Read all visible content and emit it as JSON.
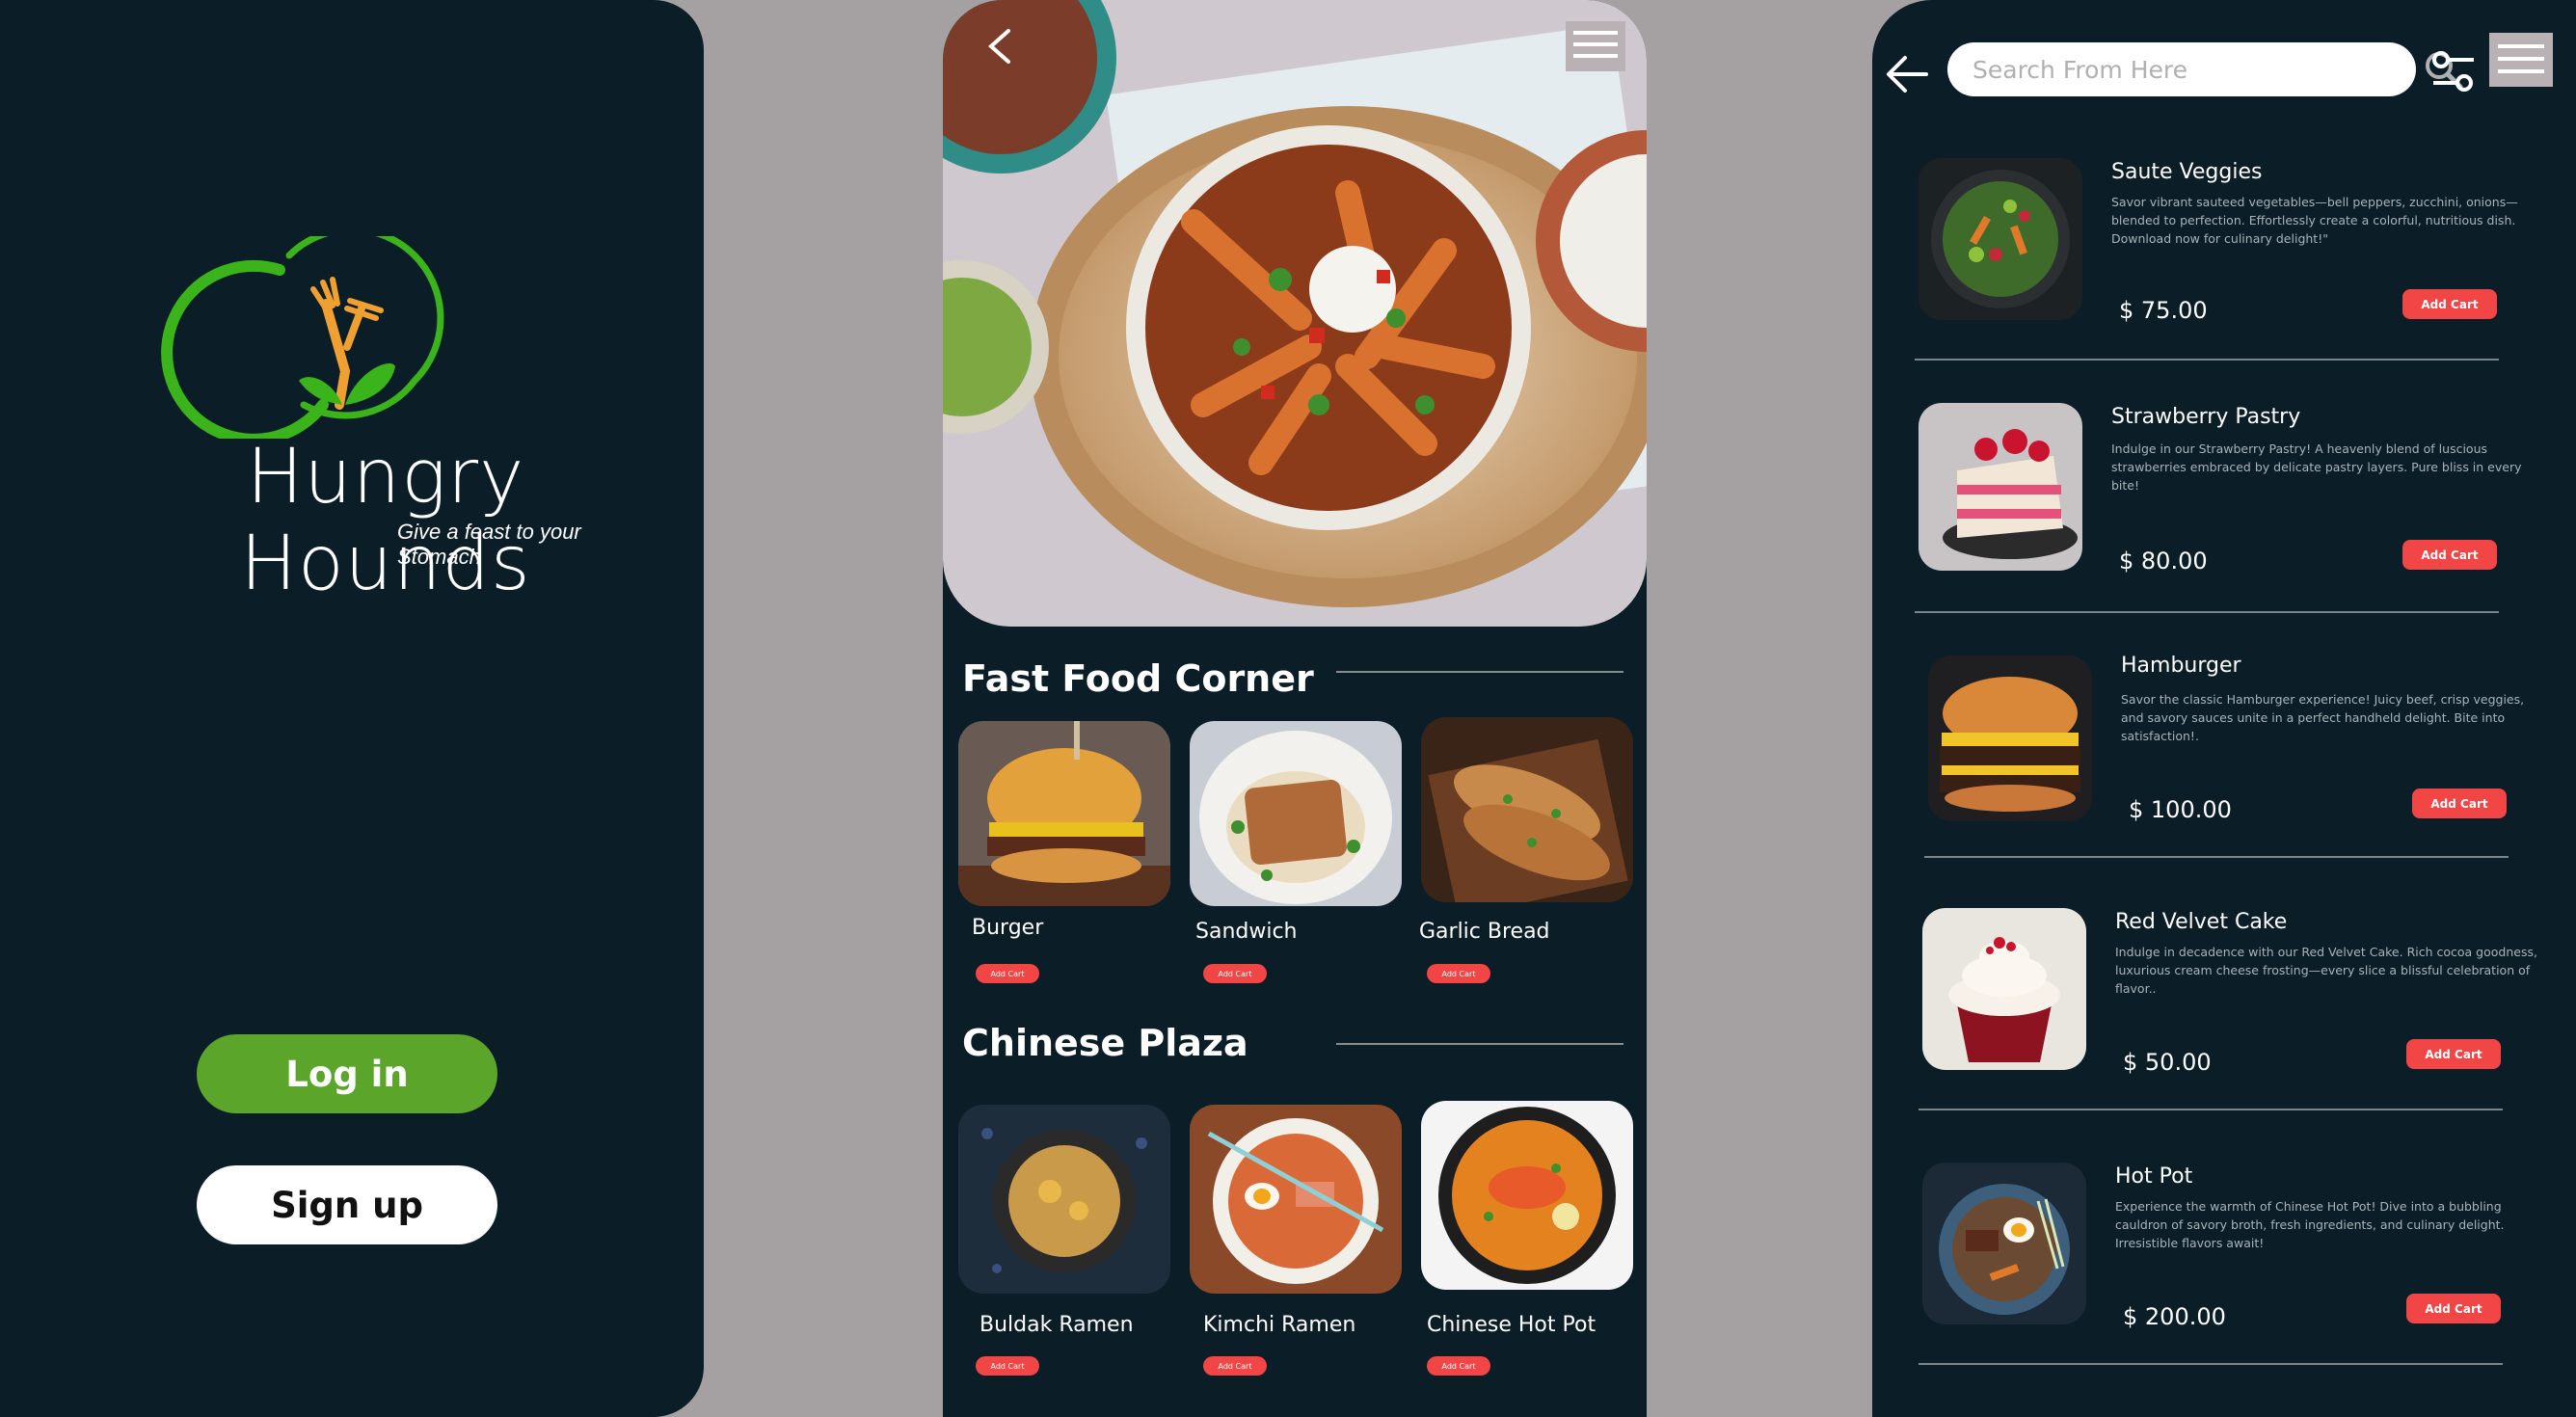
{
  "welcome": {
    "brand": "Hungry Hounds",
    "tagline": "Give a feast to your Stomach",
    "login_label": "Log in",
    "signup_label": "Sign up"
  },
  "home": {
    "sections": [
      {
        "title": "Fast Food Corner",
        "items": [
          {
            "name": "Burger",
            "button": "Add Cart"
          },
          {
            "name": "Sandwich",
            "button": "Add Cart"
          },
          {
            "name": "Garlic Bread",
            "button": "Add Cart"
          }
        ]
      },
      {
        "title": "Chinese Plaza",
        "items": [
          {
            "name": "Buldak Ramen",
            "button": "Add Cart"
          },
          {
            "name": "Kimchi Ramen",
            "button": "Add Cart"
          },
          {
            "name": "Chinese Hot Pot",
            "button": "Add Cart"
          }
        ]
      }
    ]
  },
  "listing": {
    "search_placeholder": "Search From Here",
    "items": [
      {
        "name": "Saute Veggies",
        "description": "Savor vibrant sauteed vegetables—bell peppers, zucchini, onions—blended to perfection. Effortlessly create a colorful, nutritious dish. Download now for culinary delight!\"",
        "price": "$ 75.00",
        "button": "Add Cart"
      },
      {
        "name": "Strawberry Pastry",
        "description": "Indulge in our Strawberry Pastry! A heavenly blend of luscious strawberries embraced by delicate pastry layers. Pure bliss in every bite!",
        "price": "$ 80.00",
        "button": "Add Cart"
      },
      {
        "name": "Hamburger",
        "description": "Savor the classic Hamburger experience! Juicy beef, crisp veggies, and savory sauces unite in a perfect handheld delight. Bite into satisfaction!.",
        "price": "$ 100.00",
        "button": "Add Cart"
      },
      {
        "name": "Red Velvet Cake",
        "description": "Indulge in decadence with our Red Velvet Cake. Rich cocoa goodness, luxurious cream cheese frosting—every slice a blissful celebration of flavor..",
        "price": "$ 50.00",
        "button": "Add Cart"
      },
      {
        "name": "Hot Pot",
        "description": "Experience the warmth of Chinese Hot Pot! Dive into a bubbling cauldron of savory broth, fresh ingredients, and culinary delight. Irresistible flavors await!",
        "price": "$ 200.00",
        "button": "Add Cart"
      }
    ]
  },
  "colors": {
    "panel_bg": "#0b1e28",
    "page_bg": "#a5a0a1",
    "login_green": "#5aa52a",
    "accent_red": "#f24545",
    "logo_green": "#3bb31b",
    "logo_orange": "#f0a030"
  },
  "icons": [
    "back-chevron-icon",
    "menu-icon",
    "back-arrow-icon",
    "search-icon",
    "filter-icon",
    "fork-leaf-logo-icon"
  ]
}
